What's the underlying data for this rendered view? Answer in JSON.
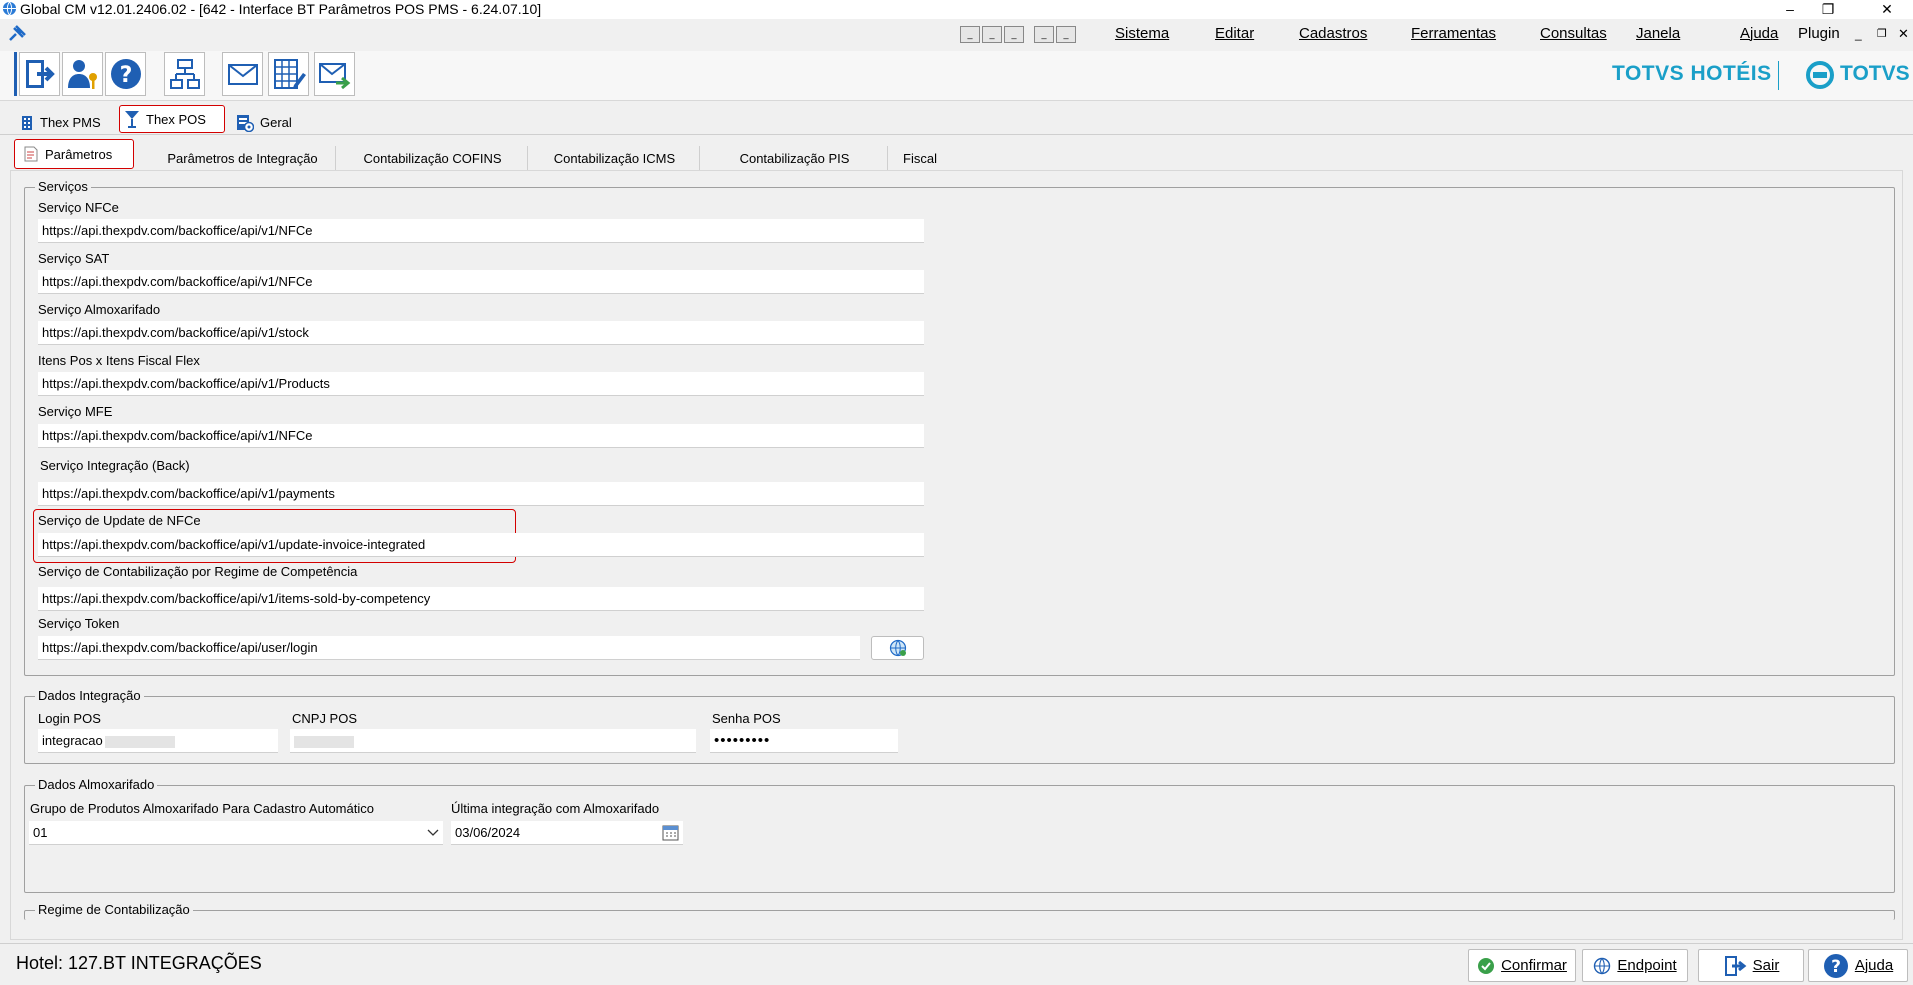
{
  "window": {
    "title": "Global CM v12.01.2406.02 - [642 - Interface BT Parâmetros POS PMS - 6.24.07.10]"
  },
  "menu": {
    "items": [
      "Sistema",
      "Editar",
      "Cadastros",
      "Ferramentas",
      "Consultas",
      "Janela",
      "Ajuda",
      "Plugin"
    ]
  },
  "brand": {
    "left": "TOTVS HOTÉIS",
    "right": "TOTVS",
    "color": "#1a9fc8"
  },
  "top_tabs": [
    {
      "label": "Thex PMS",
      "icon": "building-icon"
    },
    {
      "label": "Thex POS",
      "icon": "cocktail-icon",
      "active": true
    },
    {
      "label": "Geral",
      "icon": "settings-doc-icon"
    }
  ],
  "sub_tabs": [
    {
      "label": "Parâmetros",
      "active": true
    },
    {
      "label": "Parâmetros de Integração"
    },
    {
      "label": "Contabilização COFINS"
    },
    {
      "label": "Contabilização ICMS"
    },
    {
      "label": "Contabilização PIS"
    },
    {
      "label": "Fiscal"
    }
  ],
  "servicos": {
    "legend": "Serviços",
    "fields": [
      {
        "label": "Serviço NFCe",
        "value": "https://api.thexpdv.com/backoffice/api/v1/NFCe"
      },
      {
        "label": "Serviço SAT",
        "value": "https://api.thexpdv.com/backoffice/api/v1/NFCe"
      },
      {
        "label": "Serviço Almoxarifado",
        "value": "https://api.thexpdv.com/backoffice/api/v1/stock"
      },
      {
        "label": "Itens Pos x Itens Fiscal Flex",
        "value": "https://api.thexpdv.com/backoffice/api/v1/Products"
      },
      {
        "label": "Serviço MFE",
        "value": "https://api.thexpdv.com/backoffice/api/v1/NFCe"
      },
      {
        "label": "Serviço Integração (Back)",
        "value": "https://api.thexpdv.com/backoffice/api/v1/payments"
      },
      {
        "label": "Serviço de Update de NFCe",
        "value": "https://api.thexpdv.com/backoffice/api/v1/update-invoice-integrated"
      },
      {
        "label": "Serviço de Contabilização por Regime de Competência",
        "value": "https://api.thexpdv.com/backoffice/api/v1/items-sold-by-competency"
      },
      {
        "label": "Serviço Token",
        "value": "https://api.thexpdv.com/backoffice/api/user/login"
      }
    ]
  },
  "dados_integracao": {
    "legend": "Dados Integração",
    "login_label": "Login POS",
    "login_value": "integracao",
    "cnpj_label": "CNPJ POS",
    "cnpj_value": "",
    "senha_label": "Senha POS",
    "senha_value": "•••••••••"
  },
  "dados_almox": {
    "legend": "Dados Almoxarifado",
    "grupo_label": "Grupo de Produtos Almoxarifado Para Cadastro Automático",
    "grupo_value": "01",
    "ultima_label": "Última integração com Almoxarifado",
    "ultima_value": "03/06/2024"
  },
  "regime": {
    "legend": "Regime de Contabilização"
  },
  "status": {
    "hotel": "Hotel: 127.BT INTEGRAÇÕES"
  },
  "buttons": {
    "confirmar": "Confirmar",
    "endpoint": "Endpoint",
    "sair": "Sair",
    "ajuda": "Ajuda"
  }
}
